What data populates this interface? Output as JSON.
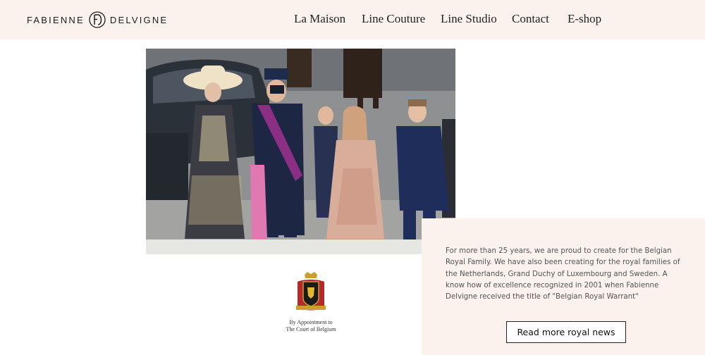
{
  "brand": {
    "name_left": "FABIENNE",
    "name_right": "DELVIGNE",
    "monogram": "FD"
  },
  "nav": {
    "items": [
      "La Maison",
      "Line Couture",
      "Line Studio",
      "Contact",
      "E-shop"
    ]
  },
  "warrant": {
    "line1": "By Appointment to",
    "line2": "The Court of Belgium"
  },
  "royal": {
    "text": "For more than 25 years, we are proud to create for the Belgian Royal Family. We have also been creating for the royal families of the Netherlands, Grand Duchy of Luxembourg and Sweden. A know how of excellence recognized in 2001 when Fabienne Delvigne received the title of \"Belgian Royal Warrant\"",
    "button_label": "Read more royal news"
  },
  "colors": {
    "header_bg": "#fbf2ee",
    "panel_bg": "#fbf2ee",
    "text_dark": "#222222"
  },
  "icons": [
    "fd-monogram-icon",
    "royal-crest-icon"
  ]
}
